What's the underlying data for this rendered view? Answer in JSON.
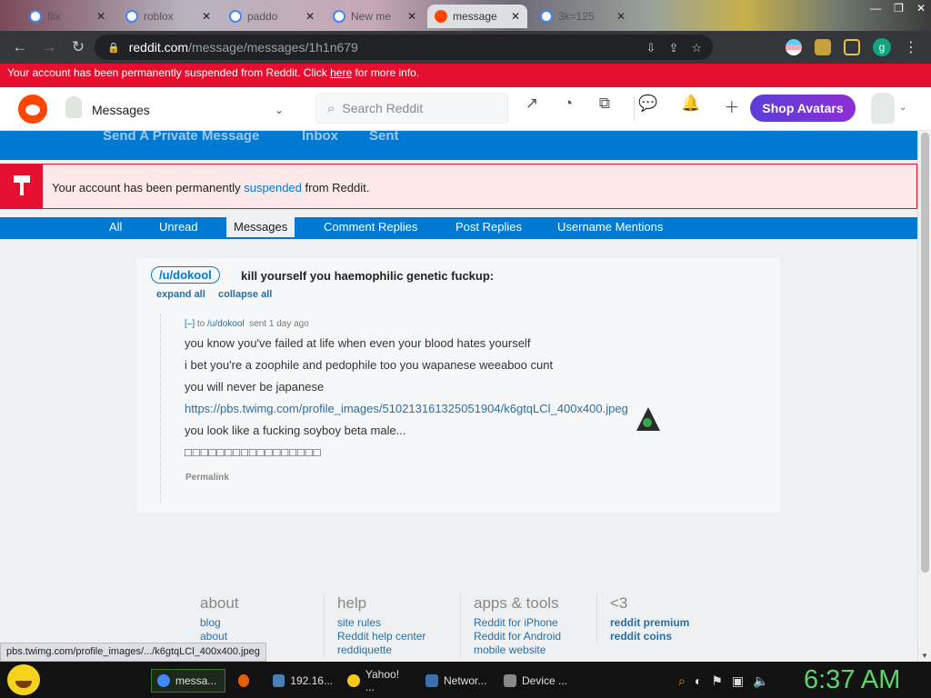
{
  "browser": {
    "tabs": [
      {
        "label": "flix",
        "active": false
      },
      {
        "label": "roblox",
        "active": false
      },
      {
        "label": "paddo",
        "active": false
      },
      {
        "label": "New me",
        "active": false
      },
      {
        "label": "message",
        "active": true
      },
      {
        "label": "3k=125",
        "active": false
      }
    ],
    "url_host": "reddit.com",
    "url_path": "/message/messages/1h1n679",
    "profile_initial": "g"
  },
  "suspension_banner": {
    "text_before": "Your account has been permanently suspended from Reddit. Click ",
    "link": "here",
    "text_after": " for more info."
  },
  "header": {
    "section": "Messages",
    "search_placeholder": "Search Reddit",
    "shop_label": "Shop Avatars"
  },
  "msg_nav": {
    "items": [
      "Send A Private Message",
      "Inbox",
      "Sent"
    ]
  },
  "suspension_box": {
    "text_before": "Your account has been permanently ",
    "link": "suspended",
    "text_after": " from Reddit."
  },
  "subtabs": [
    "All",
    "Unread",
    "Messages",
    "Comment Replies",
    "Post Replies",
    "Username Mentions"
  ],
  "message": {
    "user_badge": "/u/dokool",
    "subject": "kill yourself you haemophilic genetic fuckup:",
    "expand_all": "expand all",
    "collapse_all": "collapse all",
    "meta_toggle": "[–]",
    "meta_to_word": "to",
    "meta_to": "/u/dokool",
    "meta_sent": "sent 1 day ago",
    "lines": [
      "you know you've failed at life when even your blood hates yourself",
      "i bet you're a zoophile and pedophile too you wapanese weeaboo cunt",
      "you will never be japanese",
      "https://pbs.twimg.com/profile_images/510213161325051904/k6gtqLCl_400x400.jpeg",
      "you look like a fucking soyboy beta male...",
      "□□□□□□□□□□□□□□□□□"
    ],
    "permalink": "Permalink"
  },
  "footer": {
    "columns": [
      {
        "title": "about",
        "links": [
          "blog",
          "about"
        ],
        "bold": false
      },
      {
        "title": "help",
        "links": [
          "site rules",
          "Reddit help center",
          "reddiquette"
        ],
        "bold": false
      },
      {
        "title": "apps & tools",
        "links": [
          "Reddit for iPhone",
          "Reddit for Android",
          "mobile website"
        ],
        "bold": false
      },
      {
        "title": "<3",
        "links": [
          "reddit premium",
          "reddit coins"
        ],
        "bold": true
      }
    ]
  },
  "status_url": "pbs.twimg.com/profile_images/.../k6gtqLCl_400x400.jpeg",
  "taskbar": {
    "items": [
      "messa...",
      "",
      "192.16...",
      "Yahoo! ...",
      "Networ...",
      "Device ..."
    ],
    "clock": "6:37 AM"
  }
}
